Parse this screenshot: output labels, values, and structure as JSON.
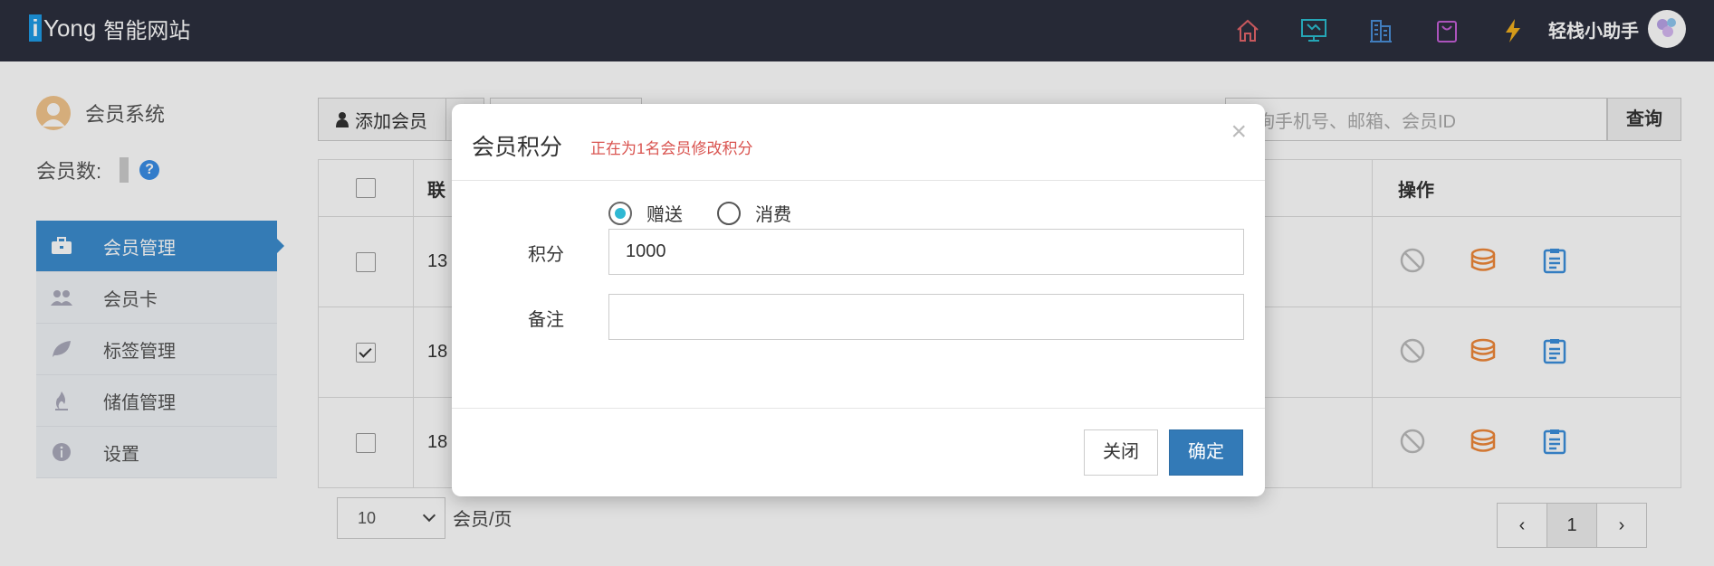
{
  "header": {
    "logo_i": "i",
    "logo_brand": "Yong",
    "logo_cn": "智能网站",
    "nav_icons": [
      "home-icon",
      "monitor-icon",
      "building-icon",
      "bag-icon",
      "lightning-icon"
    ],
    "helper_label": "轻栈小助手"
  },
  "sidebar": {
    "title": "会员系统",
    "count_label": "会员数:",
    "help": "?",
    "items": [
      {
        "label": "会员管理",
        "icon": "briefcase-icon",
        "active": true
      },
      {
        "label": "会员卡",
        "icon": "users-icon",
        "active": false
      },
      {
        "label": "标签管理",
        "icon": "leaf-icon",
        "active": false
      },
      {
        "label": "储值管理",
        "icon": "flame-icon",
        "active": false
      },
      {
        "label": "设置",
        "icon": "info-icon",
        "active": false
      }
    ]
  },
  "toolbar": {
    "add_label": "添加会员",
    "search_placeholder": "查询手机号、邮箱、会员ID",
    "search_button": "查询"
  },
  "table": {
    "head_col": "联",
    "op_header": "操作",
    "rows": [
      {
        "phone": "13",
        "checked": false
      },
      {
        "phone": "18",
        "checked": true
      },
      {
        "phone": "18",
        "checked": false
      }
    ]
  },
  "pagination": {
    "page_size": "10",
    "page_size_label": "会员/页",
    "prev": "‹",
    "current": "1",
    "next": "›"
  },
  "modal": {
    "title": "会员积分",
    "subtitle": "正在为1名会员修改积分",
    "close": "×",
    "radio_give": "赠送",
    "radio_consume": "消费",
    "points_label": "积分",
    "points_value": "1000",
    "remark_label": "备注",
    "remark_value": "",
    "btn_close": "关闭",
    "btn_ok": "确定"
  },
  "colors": {
    "topbar": "#2c2f3e",
    "accent": "#3c8dcf",
    "primary_button": "#337ab7",
    "warning_text": "#d9534f",
    "radio_dot": "#2fb8d3"
  }
}
